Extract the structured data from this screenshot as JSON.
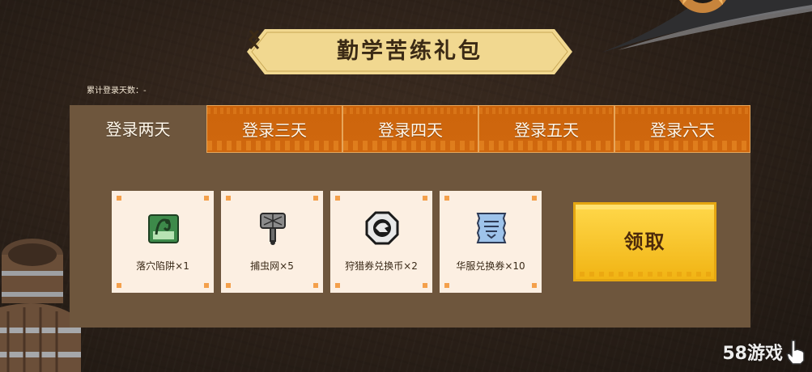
{
  "colors": {
    "tab_orange": "#d0680e",
    "panel_brown": "#6e563d",
    "card_bg": "#fcefe2",
    "banner_gold": "#f1d890",
    "claim_gold": "#f8c421"
  },
  "header": {
    "title": "勤学苦练礼包",
    "prev_icon": "chevron-left-icon",
    "next_icon": "chevron-right-icon"
  },
  "login_days_label": "累计登录天数：-",
  "tabs": [
    {
      "label": "登录两天",
      "active": true
    },
    {
      "label": "登录三天",
      "active": false
    },
    {
      "label": "登录四天",
      "active": false
    },
    {
      "label": "登录五天",
      "active": false
    },
    {
      "label": "登录六天",
      "active": false
    }
  ],
  "rewards": [
    {
      "label": "落穴陷阱×1",
      "icon": "pitfall-trap-icon"
    },
    {
      "label": "捕虫网×5",
      "icon": "bug-net-icon"
    },
    {
      "label": "狩猎券兑换币×2",
      "icon": "hunt-coin-icon"
    },
    {
      "label": "华服兑换券×10",
      "icon": "outfit-ticket-icon"
    }
  ],
  "claim_button": {
    "label": "领取"
  },
  "watermark": {
    "text": "58游戏",
    "icon": "hand-pointer-icon"
  }
}
